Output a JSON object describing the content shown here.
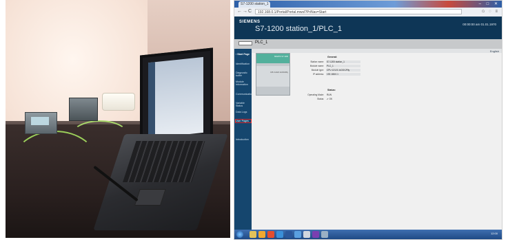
{
  "browser": {
    "tab_title": "S7-1200 station_1",
    "url": "192.168.0.1/Portal/Portal.mwsl?PriNav=Start",
    "window_controls": "– □ ✕",
    "nav_back": "←",
    "nav_forward": "→",
    "nav_reload": "C",
    "addr_icons": "✩ ◌ ≡"
  },
  "header": {
    "brand": "SIEMENS",
    "station_title": "S7-1200 station_1/PLC_1",
    "datetime": "00:00:00 am  01.01.1970"
  },
  "subheader": {
    "plc_name": "PLC_1"
  },
  "sidebar": {
    "items": [
      {
        "label": "› Start Page",
        "state": "active"
      },
      {
        "label": "Identification",
        "state": "normal"
      },
      {
        "label": "Diagnostic buffer",
        "state": "normal"
      },
      {
        "label": "Module information",
        "state": "normal"
      },
      {
        "label": "Communication",
        "state": "normal"
      },
      {
        "label": "Variable Status",
        "state": "normal"
      },
      {
        "label": "Data Logs",
        "state": "normal"
      },
      {
        "label": "User Pages",
        "state": "selected"
      },
      {
        "label": "Introduction",
        "state": "normal"
      }
    ]
  },
  "content": {
    "language": "English",
    "device_label": "SIMATIC S7-1200",
    "device_cpu": "CPU 1212C AC/DC/Rly",
    "general": {
      "title": "General:",
      "rows": [
        {
          "key": "Station name:",
          "value": "S7-1200 station_1"
        },
        {
          "key": "Module name:",
          "value": "PLC_1"
        },
        {
          "key": "Module type:",
          "value": "CPU 1212C AC/DC/Rly"
        },
        {
          "key": "IP address:",
          "value": "192.168.0.1"
        }
      ]
    },
    "status": {
      "title": "Status:",
      "rows": [
        {
          "key": "Operating Mode:",
          "value": "RUN"
        },
        {
          "key": "Status:",
          "value": "✔ OK"
        }
      ]
    }
  },
  "taskbar": {
    "tray_time": "12:00"
  },
  "colors": {
    "header": "#0e3656",
    "sidebar": "#15466e",
    "device_top": "#52b09c",
    "highlight": "#e02a2a"
  }
}
